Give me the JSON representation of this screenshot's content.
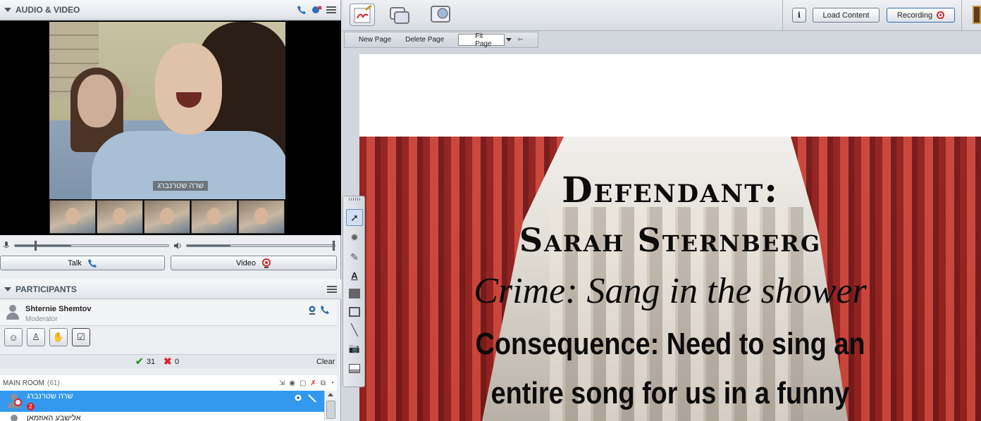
{
  "audio_video": {
    "title": "AUDIO & VIDEO",
    "main_video_name": "שרה שטרנברג",
    "talk_label": "Talk",
    "video_label": "Video"
  },
  "participants": {
    "title": "PARTICIPANTS",
    "moderator_name": "Shternie Shemtov",
    "moderator_role": "Moderator",
    "yes_count": "31",
    "no_count": "0",
    "clear_label": "Clear",
    "main_room_label": "MAIN ROOM",
    "main_room_count": "(61)",
    "rows": [
      {
        "name": "שרה שטרנברג",
        "badge": "2",
        "selected": true
      },
      {
        "name": "אלישבע האוזמאן",
        "badge": "",
        "selected": false
      }
    ]
  },
  "toolbar": {
    "load_content_label": "Load Content",
    "recording_label": "Recording",
    "info_label": "i"
  },
  "page_bar": {
    "new_page_label": "New Page",
    "delete_page_label": "Delete Page",
    "fit_value": "Fit Page"
  },
  "slide": {
    "line1": "Defendant:",
    "line2": "Sarah Sternberg",
    "line3": "Crime: Sang in the shower",
    "line4": "Consequence: Need to sing an",
    "line5": "entire song for us in a funny"
  },
  "colors": {
    "selected_row": "#3399ee",
    "record_red": "#d9232e",
    "curtain_red": "#b3261e"
  }
}
